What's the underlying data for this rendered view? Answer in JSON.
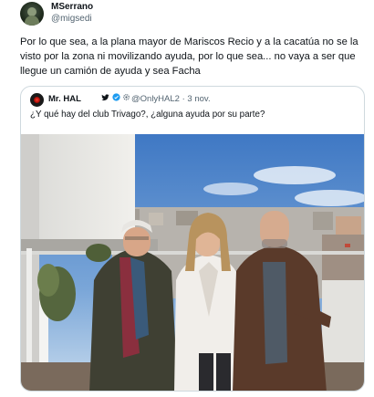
{
  "author": {
    "display_name": "MSerrano",
    "handle": "@migsedi",
    "avatar_icon": "profile-avatar"
  },
  "tweet": {
    "text": "Por lo que sea, a la plana mayor de Mariscos Recio y a la cacatúa no se la visto por la zona ni movilizando ayuda, por lo que sea... no vaya a ser que llegue un camión de ayuda y sea Facha"
  },
  "quoted": {
    "display_name": "Mr. HAL",
    "icons": [
      "twitter-bird-icon",
      "verified-badge-icon",
      "gear-icon"
    ],
    "handle": "@OnlyHAL2",
    "separator": "·",
    "date": "3 nov.",
    "text": "¿Y qué hay del club Trivago?, ¿alguna ayuda por su parte?",
    "photo_icon": "group-photo-rooftop"
  },
  "colors": {
    "text_primary": "#0f1419",
    "text_secondary": "#536471",
    "border": "#cfd9de",
    "verified": "#1d9bf0",
    "sky": "#5f92cf"
  }
}
